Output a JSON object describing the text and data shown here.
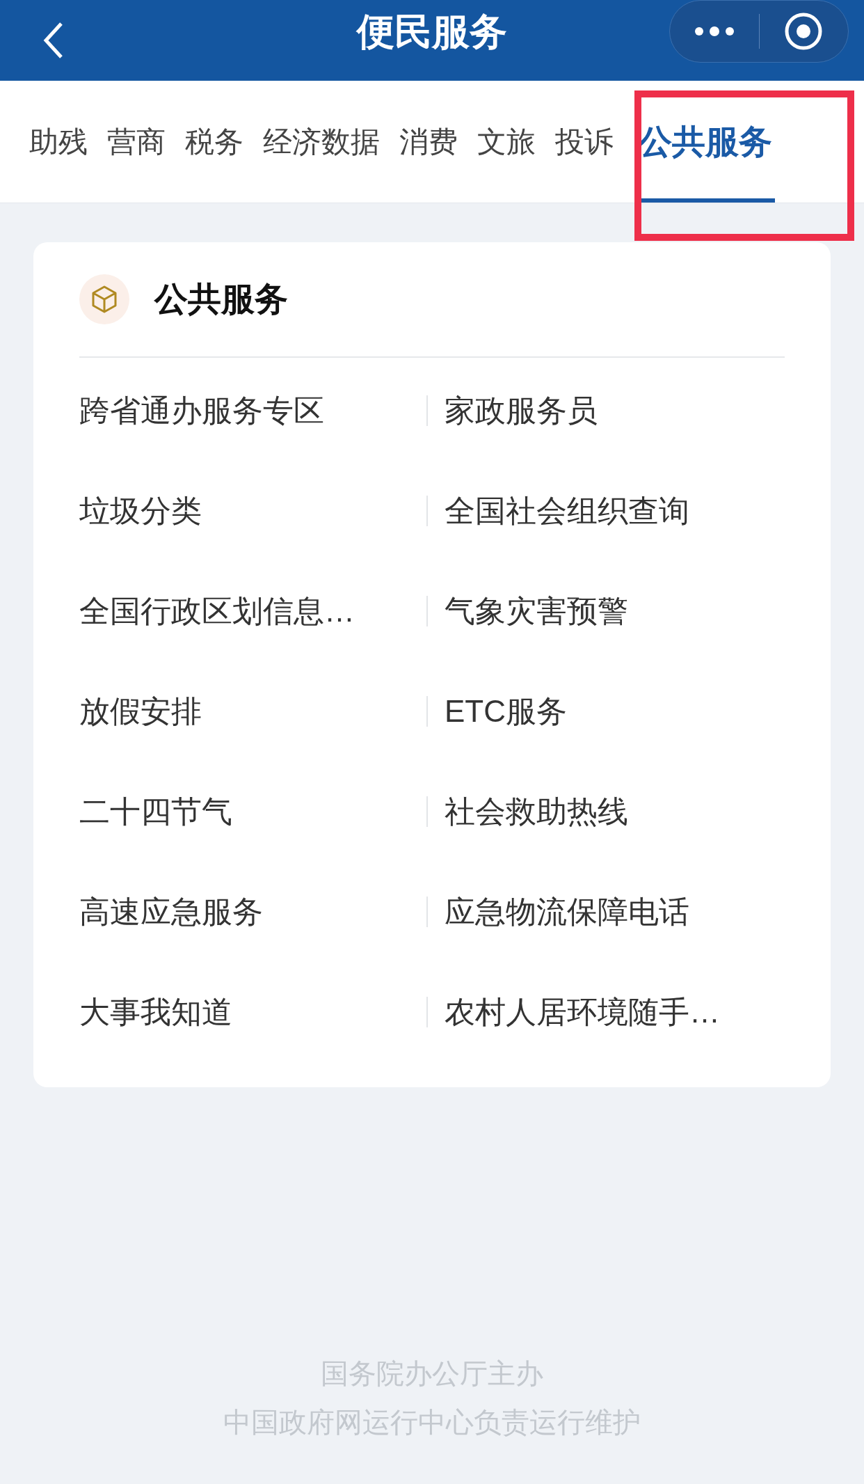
{
  "nav_bar": {
    "title": "便民服务"
  },
  "tabs": [
    {
      "label": "助残",
      "selected": false
    },
    {
      "label": "营商",
      "selected": false
    },
    {
      "label": "税务",
      "selected": false
    },
    {
      "label": "经济数据",
      "selected": false
    },
    {
      "label": "消费",
      "selected": false
    },
    {
      "label": "文旅",
      "selected": false
    },
    {
      "label": "投诉",
      "selected": false
    },
    {
      "label": "公共服务",
      "selected": true
    }
  ],
  "card": {
    "title": "公共服务",
    "items": [
      "跨省通办服务专区",
      "家政服务员",
      "垃圾分类",
      "全国社会组织查询",
      "全国行政区划信息…",
      "气象灾害预警",
      "放假安排",
      "ETC服务",
      "二十四节气",
      "社会救助热线",
      "高速应急服务",
      "应急物流保障电话",
      "大事我知道",
      "农村人居环境随手…"
    ]
  },
  "footer": [
    "国务院办公厅主办",
    "中国政府网运行中心负责运行维护"
  ]
}
